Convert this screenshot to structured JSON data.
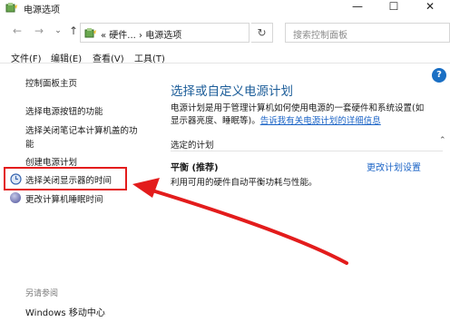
{
  "window": {
    "title": "电源选项",
    "minimize_glyph": "—",
    "maximize_glyph": "☐",
    "close_glyph": "✕"
  },
  "nav": {
    "back_glyph": "←",
    "forward_glyph": "→",
    "dropdown_glyph": "⌄",
    "up_glyph": "↑",
    "address_path": "«  硬件...  ›  电源选项",
    "address_dropdown_glyph": "⌄",
    "refresh_glyph": "↻",
    "search_placeholder": "搜索控制面板"
  },
  "menu": [
    "文件(F)",
    "编辑(E)",
    "查看(V)",
    "工具(T)"
  ],
  "help_glyph": "?",
  "sidebar": {
    "home": "控制面板主页",
    "items": [
      "选择电源按钮的功能",
      "选择关闭笔记本计算机盖的功",
      "能",
      "创建电源计划",
      "选择关闭显示器的时间",
      "更改计算机睡眠时间"
    ],
    "see_also_title": "另请参阅",
    "see_also_link": "Windows 移动中心"
  },
  "main": {
    "title": "选择或自定义电源计划",
    "desc_line1": "电源计划是用于管理计算机如何使用电源的一套硬件和系统设置(如",
    "desc_line2_prefix": "显示器亮度、睡眠等)。",
    "desc_link": "告诉我有关电源计划的详细信息",
    "section_label": "选定的计划",
    "expander_glyph": "⌃",
    "plan_name": "平衡 (推荐)",
    "plan_change_link": "更改计划设置",
    "plan_desc": "利用可用的硬件自动平衡功耗与性能。"
  },
  "colors": {
    "highlight_red": "#e31c1c",
    "link_blue": "#1a63c6",
    "title_blue": "#1c5d99"
  }
}
